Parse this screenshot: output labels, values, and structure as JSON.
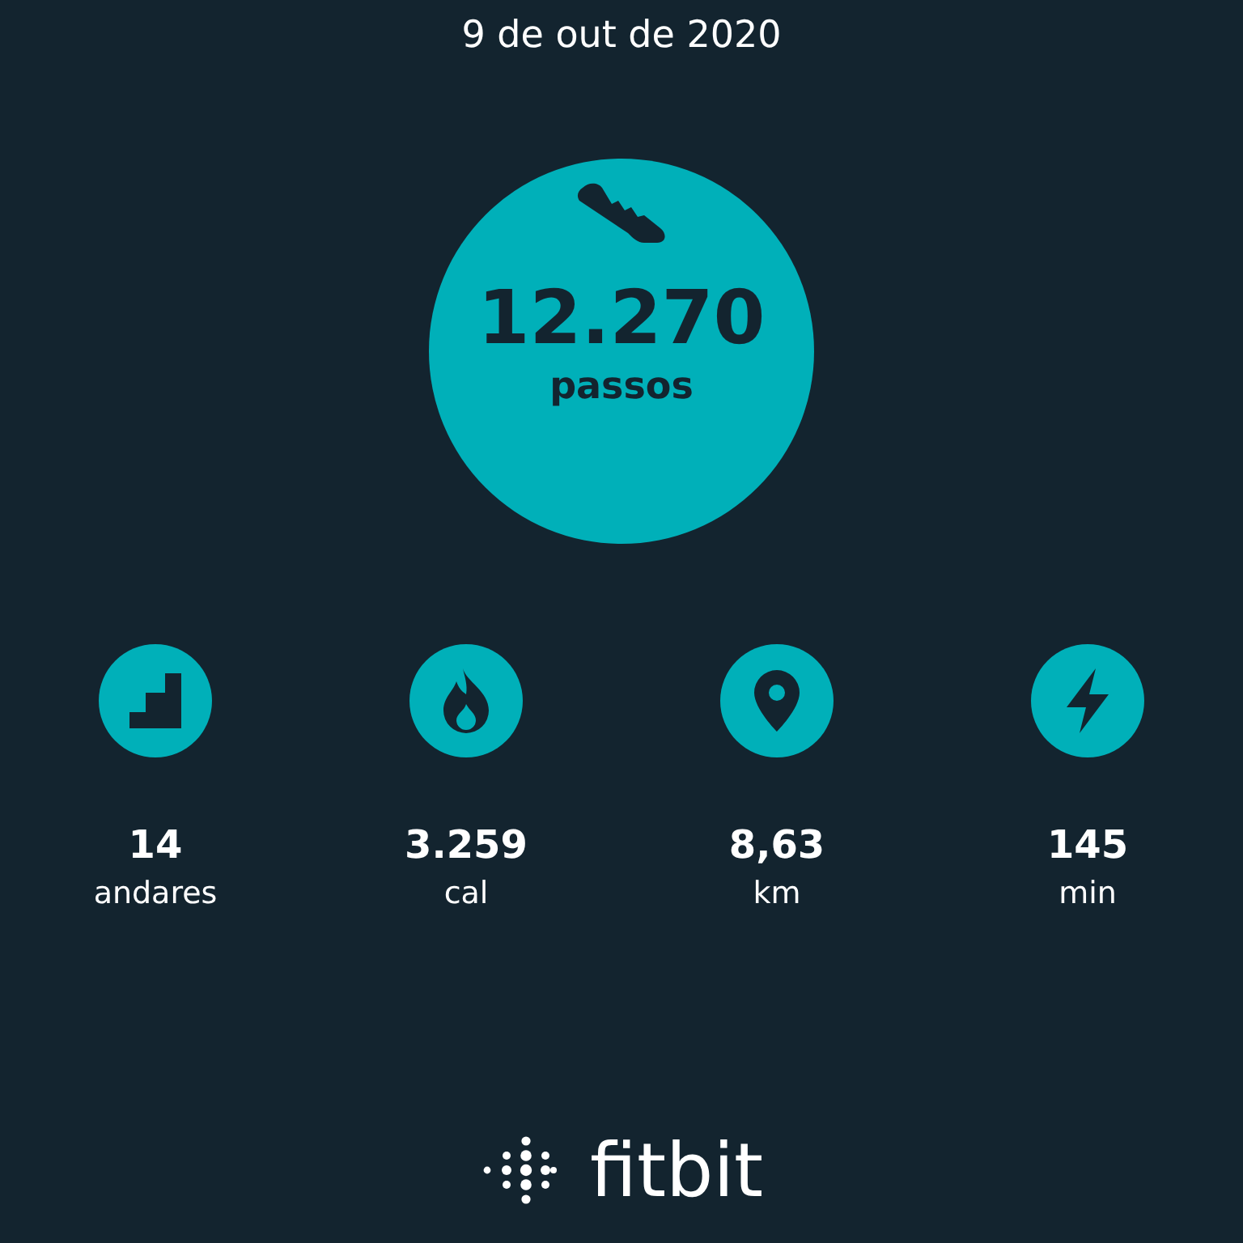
{
  "date": "9 de out de 2020",
  "steps": {
    "value": "12.270",
    "unit": "passos"
  },
  "stats": [
    {
      "kind": "floors",
      "value": "14",
      "unit": "andares"
    },
    {
      "kind": "calories",
      "value": "3.259",
      "unit": "cal"
    },
    {
      "kind": "distance",
      "value": "8,63",
      "unit": "km"
    },
    {
      "kind": "active",
      "value": "145",
      "unit": "min"
    }
  ],
  "logo": {
    "text": "fitbit"
  }
}
